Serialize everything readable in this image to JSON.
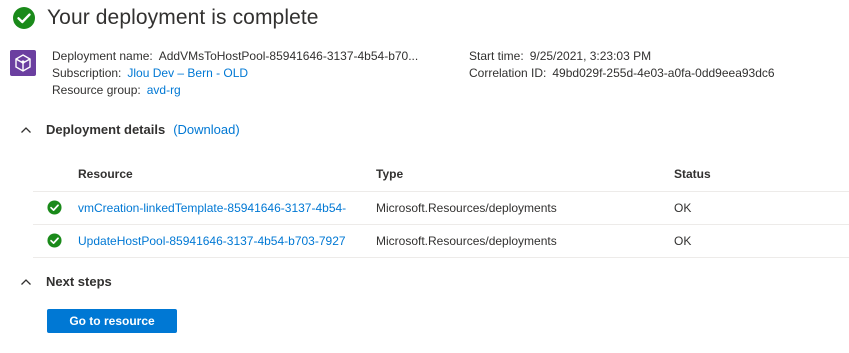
{
  "header": {
    "title": "Your deployment is complete"
  },
  "deployment_info": {
    "name_label": "Deployment name:",
    "name_value": "AddVMsToHostPool-85941646-3137-4b54-b70...",
    "subscription_label": "Subscription:",
    "subscription_value": "Jlou Dev – Bern - OLD",
    "resource_group_label": "Resource group:",
    "resource_group_value": "avd-rg",
    "start_time_label": "Start time:",
    "start_time_value": "9/25/2021, 3:23:03 PM",
    "correlation_label": "Correlation ID:",
    "correlation_value": "49bd029f-255d-4e03-a0fa-0dd9eea93dc6"
  },
  "details": {
    "title": "Deployment details",
    "download_label": "(Download)",
    "columns": {
      "resource": "Resource",
      "type": "Type",
      "status": "Status"
    },
    "rows": [
      {
        "resource": "vmCreation-linkedTemplate-85941646-3137-4b54-",
        "type": "Microsoft.Resources/deployments",
        "status": "OK"
      },
      {
        "resource": "UpdateHostPool-85941646-3137-4b54-b703-7927",
        "type": "Microsoft.Resources/deployments",
        "status": "OK"
      }
    ]
  },
  "next_steps": {
    "title": "Next steps",
    "button_label": "Go to resource"
  },
  "colors": {
    "success": "#1a8a1a",
    "link": "#0078d4",
    "primary": "#0078d4",
    "deployment_icon": "#6b3fa0"
  },
  "icons": {
    "header": "success-check-icon",
    "deployment": "deployment-cube-icon",
    "row_status": "success-check-icon",
    "collapse": "chevron-up-icon"
  }
}
